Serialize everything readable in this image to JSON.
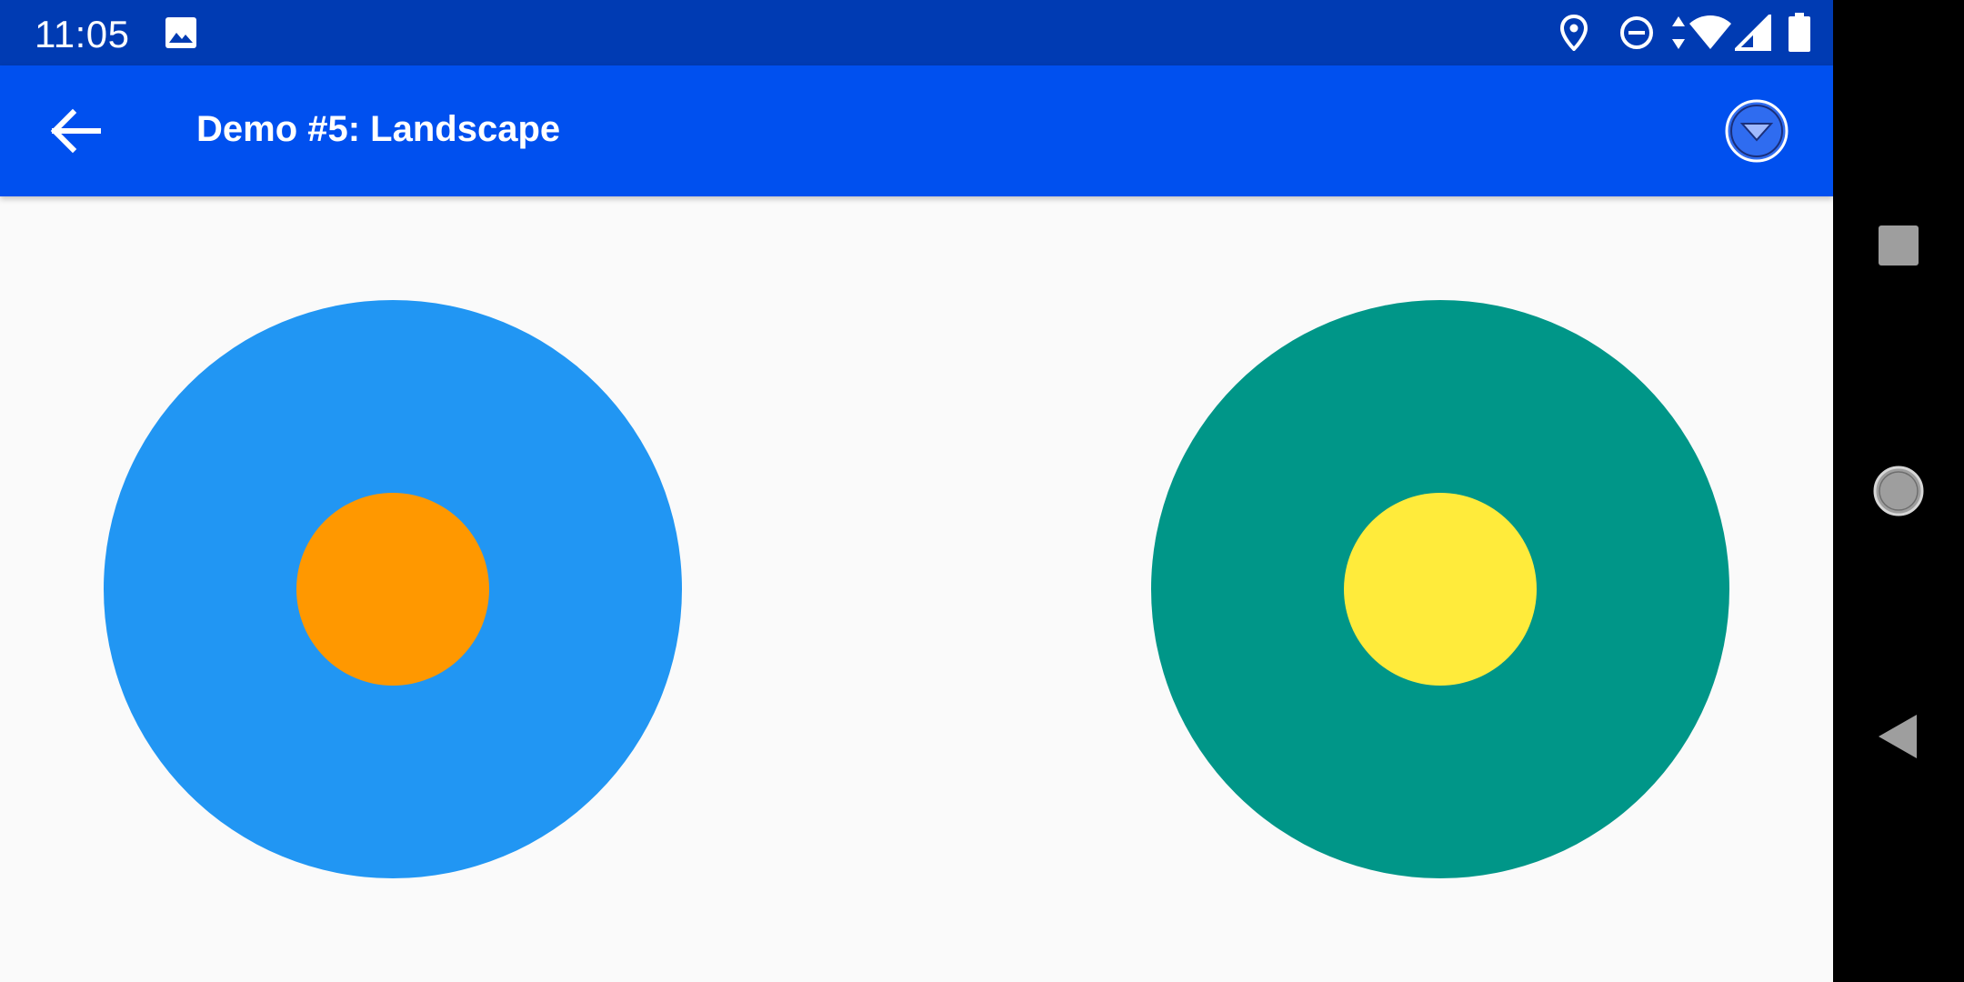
{
  "status_bar": {
    "time": "11:05",
    "icons": [
      "image-icon",
      "location-icon",
      "do-not-disturb-icon",
      "data-arrows-icon",
      "wifi-icon",
      "cell-signal-icon",
      "battery-icon"
    ]
  },
  "app_bar": {
    "title": "Demo #5: Landscape",
    "back_icon": "arrow-back-icon",
    "action_icon": "dropdown-circle-icon"
  },
  "content": {
    "circles": [
      {
        "name": "left",
        "outer_color": "#2196f3",
        "inner_color": "#ff9800"
      },
      {
        "name": "right",
        "outer_color": "#009688",
        "inner_color": "#ffeb3b"
      }
    ]
  },
  "nav_bar": {
    "buttons": [
      "recents-icon",
      "home-icon",
      "back-triangle-icon"
    ]
  },
  "colors": {
    "status_bar": "#003bb3",
    "app_bar": "#0050ef",
    "background": "#fafafa",
    "nav_bar": "#000000",
    "nav_icon": "#9e9e9e"
  }
}
